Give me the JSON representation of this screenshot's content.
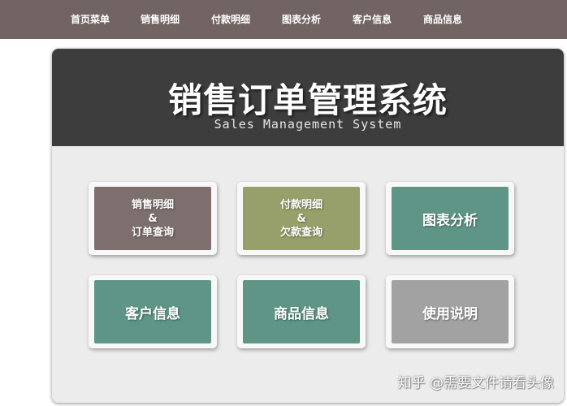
{
  "nav": {
    "items": [
      {
        "label": "首页菜单"
      },
      {
        "label": "销售明细"
      },
      {
        "label": "付款明细"
      },
      {
        "label": "图表分析"
      },
      {
        "label": "客户信息"
      },
      {
        "label": "商品信息"
      }
    ]
  },
  "banner": {
    "title": "销售订单管理系统",
    "subtitle": "Sales Management System"
  },
  "tiles": [
    {
      "line1": "销售明细",
      "line2": "&",
      "line3": "订单查询",
      "color": "#7d6f6e"
    },
    {
      "line1": "付款明细",
      "line2": "&",
      "line3": "欠款查询",
      "color": "#97a06a"
    },
    {
      "label": "图表分析",
      "color": "#5f9586"
    },
    {
      "label": "客户信息",
      "color": "#5f9586"
    },
    {
      "label": "商品信息",
      "color": "#5f9586"
    },
    {
      "label": "使用说明",
      "color": "#a2a2a2"
    }
  ],
  "watermark": {
    "text": "知乎 @需要文件请看头像"
  }
}
